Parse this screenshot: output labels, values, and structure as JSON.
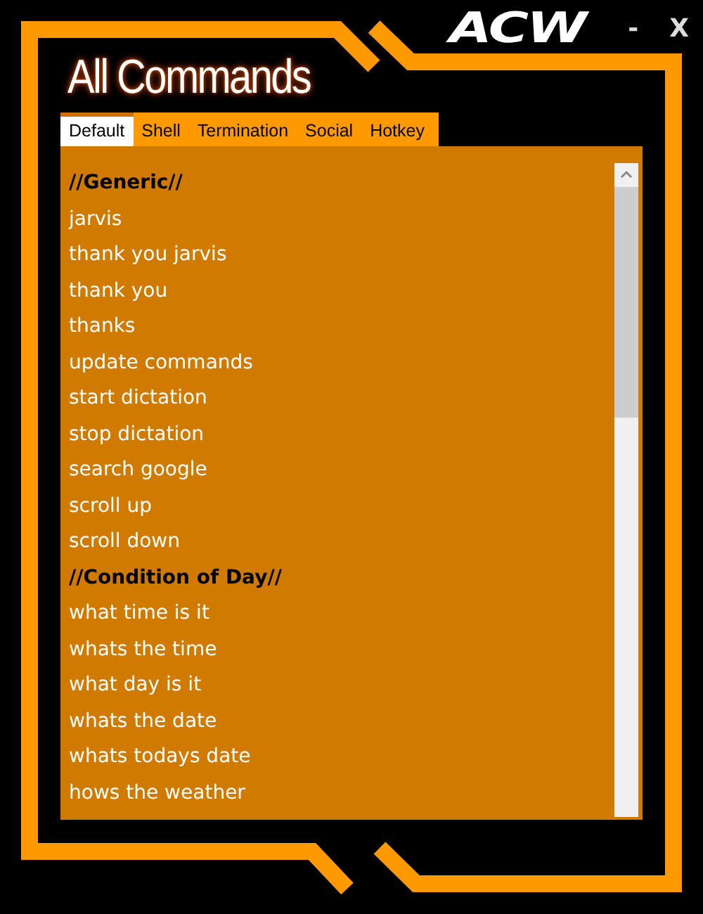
{
  "window": {
    "logo": "ACW",
    "minimize": "-",
    "close": "X"
  },
  "title": "All Commands",
  "tabs": [
    {
      "label": "Default",
      "selected": true
    },
    {
      "label": "Shell",
      "selected": false
    },
    {
      "label": "Termination",
      "selected": false
    },
    {
      "label": "Social",
      "selected": false
    },
    {
      "label": "Hotkey",
      "selected": false
    }
  ],
  "items": [
    {
      "kind": "header",
      "text": "//Generic//"
    },
    {
      "kind": "command",
      "text": "jarvis"
    },
    {
      "kind": "command",
      "text": "thank you jarvis"
    },
    {
      "kind": "command",
      "text": "thank you"
    },
    {
      "kind": "command",
      "text": "thanks"
    },
    {
      "kind": "command",
      "text": "update commands"
    },
    {
      "kind": "command",
      "text": "start dictation"
    },
    {
      "kind": "command",
      "text": "stop dictation"
    },
    {
      "kind": "command",
      "text": "search google"
    },
    {
      "kind": "command",
      "text": "scroll up"
    },
    {
      "kind": "command",
      "text": "scroll down"
    },
    {
      "kind": "header",
      "text": "//Condition of Day//"
    },
    {
      "kind": "command",
      "text": "what time is it"
    },
    {
      "kind": "command",
      "text": "whats the time"
    },
    {
      "kind": "command",
      "text": "what day is it"
    },
    {
      "kind": "command",
      "text": "whats the date"
    },
    {
      "kind": "command",
      "text": "whats todays date"
    },
    {
      "kind": "command",
      "text": "hows the weather"
    }
  ]
}
